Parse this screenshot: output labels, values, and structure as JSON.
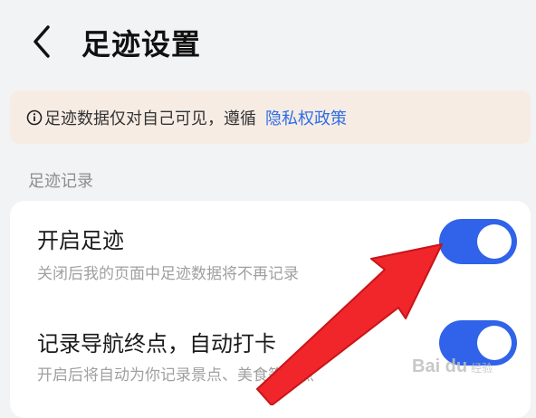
{
  "header": {
    "title": "足迹设置",
    "back_icon": "chevron-left-icon"
  },
  "notice": {
    "text": "足迹数据仅对自己可见，遵循",
    "link_text": "隐私权政策",
    "link_color": "#2f6ee6",
    "background": "#f6ece4"
  },
  "section": {
    "label": "足迹记录"
  },
  "settings": [
    {
      "title": "开启足迹",
      "description": "关闭后我的页面中足迹数据将不再记录",
      "enabled": true
    },
    {
      "title": "记录导航终点，自动打卡",
      "description": "开启后将自动为你记录景点、美食等地点",
      "enabled": true
    }
  ],
  "colors": {
    "toggle_on": "#3063e9",
    "arrow": "#f0262b"
  },
  "watermark": {
    "brand": "Bai du",
    "sub": "经验"
  }
}
